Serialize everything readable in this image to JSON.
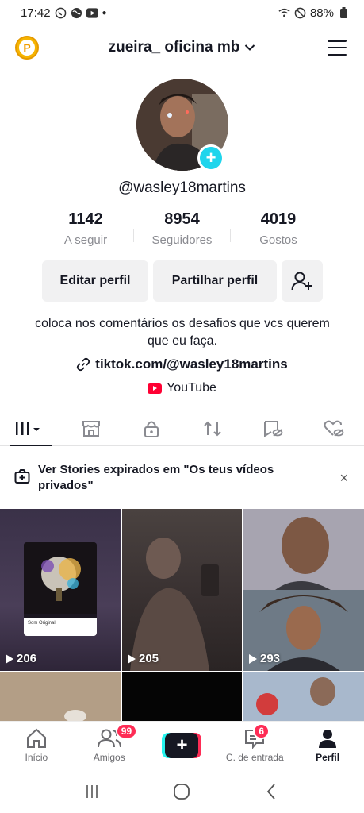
{
  "status_bar": {
    "time": "17:42",
    "battery": "88%"
  },
  "header": {
    "username": "zueira_ oficina mb",
    "coin_letter": "P"
  },
  "profile": {
    "handle": "@wasley18martins"
  },
  "stats": [
    {
      "value": "1142",
      "label": "A seguir"
    },
    {
      "value": "8954",
      "label": "Seguidores"
    },
    {
      "value": "4019",
      "label": "Gostos"
    }
  ],
  "buttons": {
    "edit": "Editar perfil",
    "share": "Partilhar perfil"
  },
  "bio": "coloca nos comentários os desafios que vcs querem que eu faça.",
  "link": "tiktok.com/@wasley18martins",
  "youtube": "YouTube",
  "notice": {
    "text": "Ver Stories expirados em \"Os teus vídeos privados\"",
    "close": "×"
  },
  "videos": [
    {
      "views": "206",
      "caption": "Som Original"
    },
    {
      "views": "205"
    },
    {
      "views": "293"
    }
  ],
  "nav": {
    "home": "Início",
    "friends": "Amigos",
    "friends_badge": "99",
    "create": "+",
    "inbox": "C. de entrada",
    "inbox_badge": "6",
    "profile": "Perfil"
  },
  "colors": {
    "accent_cyan": "#20d5ec",
    "accent_red": "#fe2c55",
    "coin": "#f6b400"
  }
}
